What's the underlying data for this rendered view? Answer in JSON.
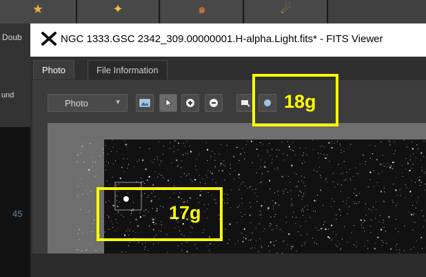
{
  "background_app": {
    "toolbar_icons": [
      "star-tool-icon",
      "sparkle-icon",
      "spiral-galaxy-icon",
      "comet-icon"
    ],
    "left_labels": [
      "Doub",
      "und",
      "45"
    ]
  },
  "window": {
    "title": "NGC 1333.GSC 2342_309.00000001.H-alpha.Light.fits* - FITS Viewer",
    "tabs": [
      {
        "label": "Photo",
        "active": true
      },
      {
        "label": "File Information",
        "active": false
      }
    ],
    "toolbar": {
      "view_mode": "Photo",
      "tools": [
        "image-icon",
        "pointer-icon",
        "zoom-in-icon",
        "zoom-out-icon",
        "fit-icon",
        "crosshair-icon"
      ]
    }
  },
  "annotations": [
    {
      "label": "18g",
      "color": "#ffff00"
    },
    {
      "label": "17g",
      "color": "#ffff00"
    }
  ]
}
